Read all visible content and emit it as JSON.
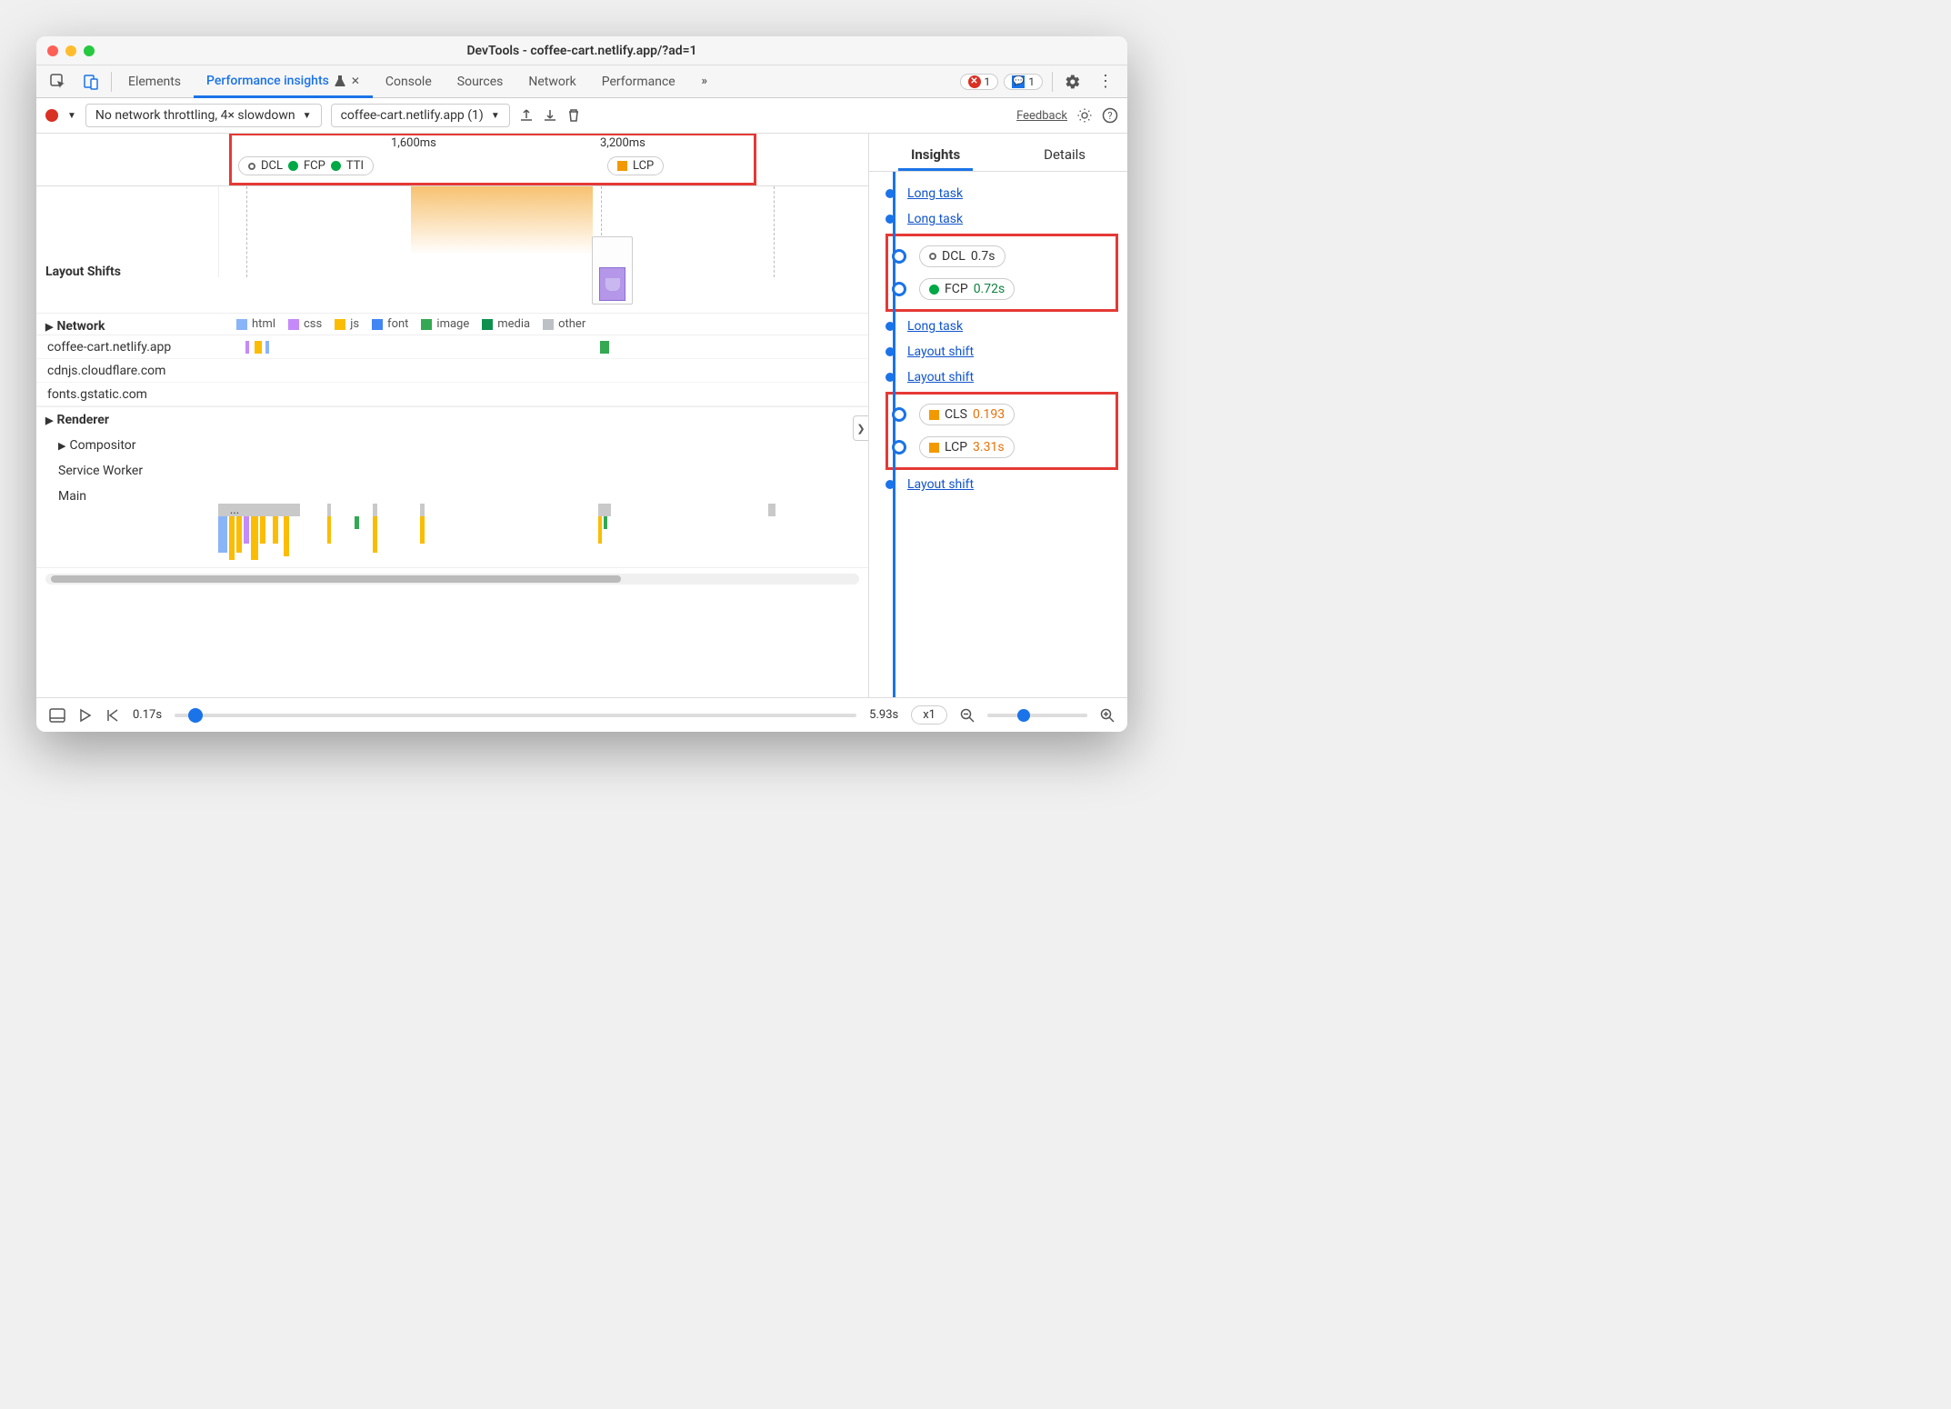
{
  "window": {
    "title": "DevTools - coffee-cart.netlify.app/?ad=1"
  },
  "tabs": {
    "elements": "Elements",
    "perf_insights": "Performance insights",
    "console": "Console",
    "sources": "Sources",
    "network": "Network",
    "performance": "Performance",
    "errors_count": "1",
    "messages_count": "1"
  },
  "toolbar": {
    "throttling": "No network throttling, 4× slowdown",
    "session": "coffee-cart.netlify.app (1)",
    "feedback": "Feedback"
  },
  "timeline": {
    "tick1": "1,600ms",
    "tick2": "3,200ms",
    "markers1": {
      "dcl": "DCL",
      "fcp": "FCP",
      "tti": "TTI"
    },
    "markers2": {
      "lcp": "LCP"
    }
  },
  "sections": {
    "layout_shifts": "Layout Shifts",
    "network": "Network",
    "renderer": "Renderer",
    "compositor": "Compositor",
    "service_worker": "Service Worker",
    "main": "Main"
  },
  "legend": {
    "html": "html",
    "css": "css",
    "js": "js",
    "font": "font",
    "image": "image",
    "media": "media",
    "other": "other"
  },
  "net_hosts": {
    "h1": "coffee-cart.netlify.app",
    "h2": "cdnjs.cloudflare.com",
    "h3": "fonts.gstatic.com"
  },
  "right": {
    "tab_insights": "Insights",
    "tab_details": "Details",
    "items": {
      "long_task": "Long task",
      "layout_shift": "Layout shift"
    },
    "metrics": {
      "dcl_label": "DCL",
      "dcl_val": "0.7s",
      "fcp_label": "FCP",
      "fcp_val": "0.72s",
      "cls_label": "CLS",
      "cls_val": "0.193",
      "lcp_label": "LCP",
      "lcp_val": "3.31s"
    }
  },
  "footer": {
    "start": "0.17s",
    "end": "5.93s",
    "speed": "x1"
  }
}
